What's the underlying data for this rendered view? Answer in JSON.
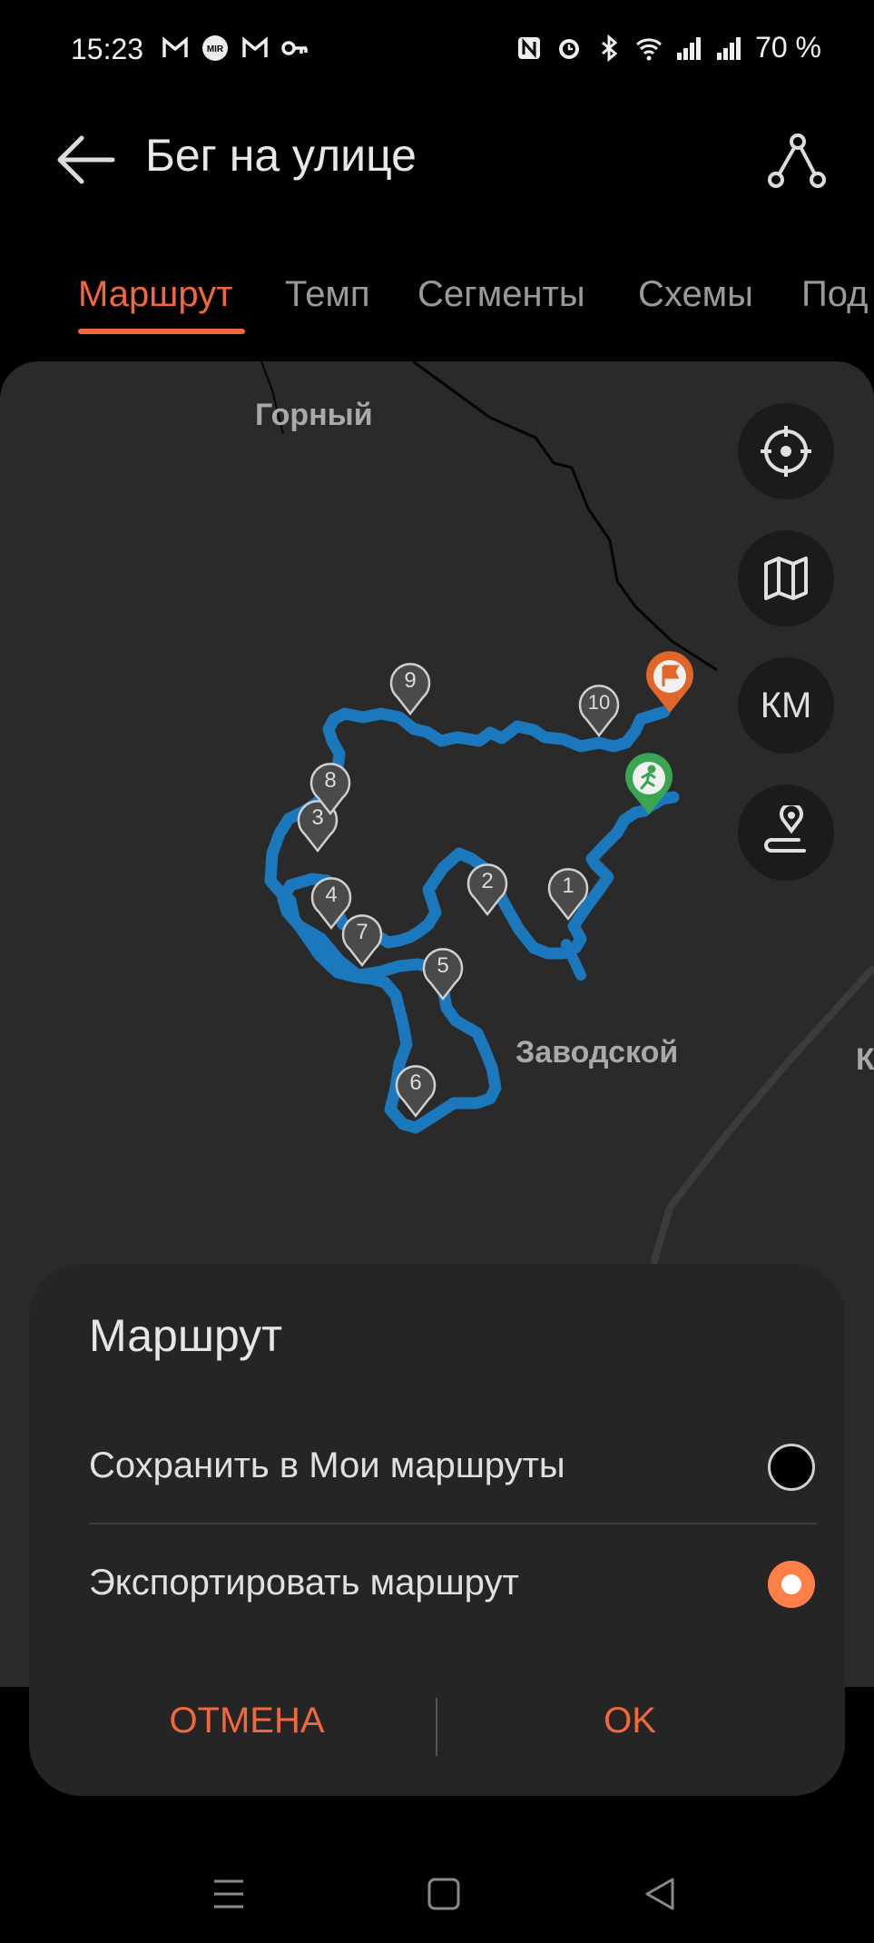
{
  "status": {
    "time": "15:23",
    "battery": "70 %",
    "left_icons": [
      "gmail-icon",
      "mir-icon",
      "gmail-icon",
      "key-icon"
    ],
    "right_icons": [
      "nfc-icon",
      "alarm-icon",
      "bluetooth-icon",
      "wifi-icon",
      "signal-icon",
      "signal-icon"
    ]
  },
  "header": {
    "title": "Бег на улице"
  },
  "tabs": [
    {
      "label": "Маршрут",
      "active": true
    },
    {
      "label": "Темп",
      "active": false
    },
    {
      "label": "Сегменты",
      "active": false
    },
    {
      "label": "Схемы",
      "active": false
    },
    {
      "label": "Под",
      "active": false
    }
  ],
  "map": {
    "places": [
      "Горный",
      "Заводской",
      "К"
    ],
    "km_markers": [
      "1",
      "2",
      "3",
      "4",
      "5",
      "6",
      "7",
      "8",
      "9",
      "10"
    ],
    "controls": {
      "units": "КМ"
    },
    "colors": {
      "route": "#1b78bd",
      "start": "#3aa551",
      "finish": "#e0662a"
    }
  },
  "dialog": {
    "title": "Маршрут",
    "options": [
      {
        "label": "Сохранить в Мои маршруты",
        "selected": false
      },
      {
        "label": "Экспортировать маршрут",
        "selected": true
      }
    ],
    "cancel": "ОТМЕНА",
    "ok": "OK"
  },
  "colors": {
    "accent": "#f2683a",
    "radio_on": "#ff7f48"
  }
}
